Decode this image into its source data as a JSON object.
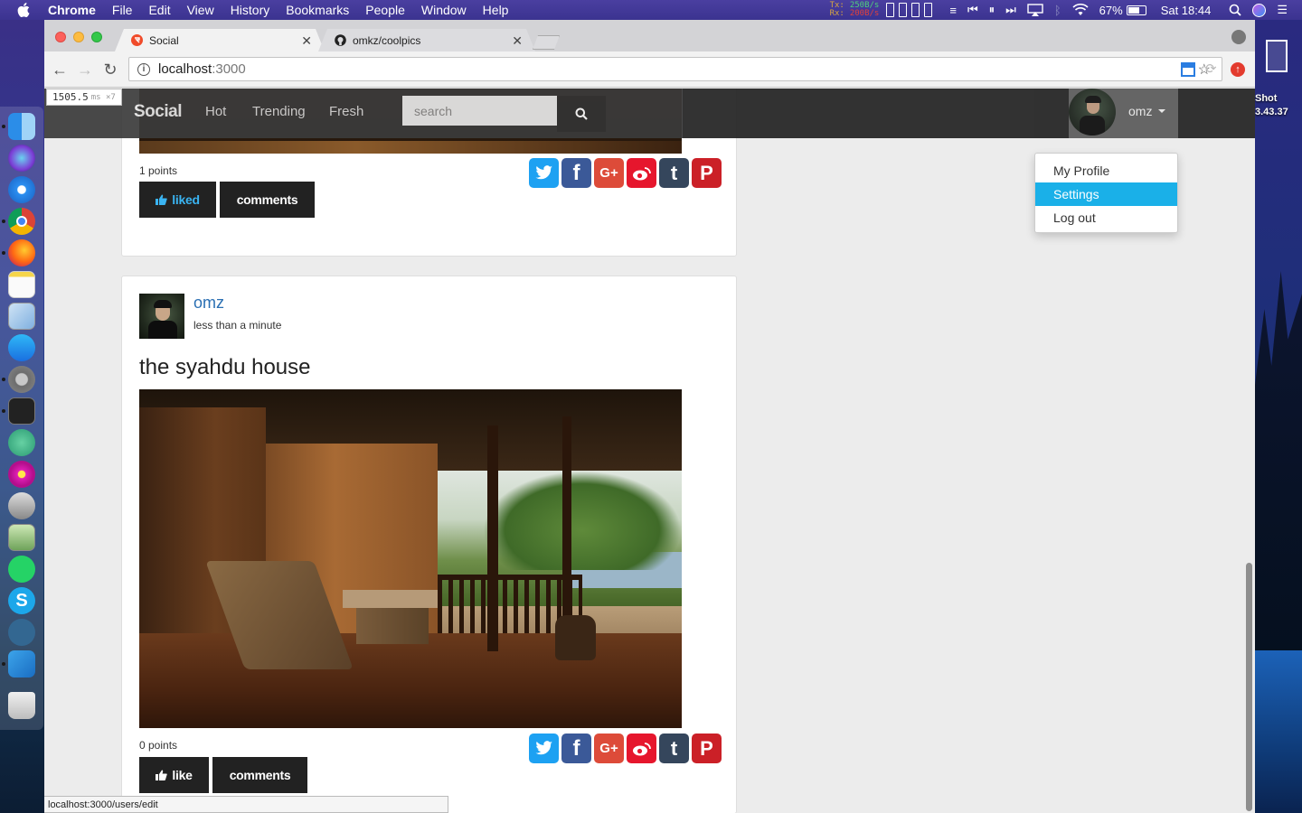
{
  "menubar": {
    "app_name": "Chrome",
    "items": [
      "File",
      "Edit",
      "View",
      "History",
      "Bookmarks",
      "People",
      "Window",
      "Help"
    ],
    "netstat": {
      "tx_label": "Tx:",
      "rx_label": "Rx:",
      "tx": "250B/s",
      "rx": "200B/s"
    },
    "battery": "67%",
    "clock": "Sat 18:44"
  },
  "desktop": {
    "icon_label_line1": "Shot",
    "icon_label_line2": "3.43.37"
  },
  "browser": {
    "tabs": [
      {
        "title": "Social",
        "active": true
      },
      {
        "title": "omkz/coolpics",
        "active": false
      }
    ],
    "url_host": "localhost",
    "url_port": ":3000",
    "status_url": "localhost:3000/users/edit"
  },
  "perf_overlay": {
    "value": "1505.5",
    "unit": "ms ×7"
  },
  "site": {
    "brand": "Social",
    "nav": [
      "Hot",
      "Trending",
      "Fresh"
    ],
    "search_placeholder": "search",
    "username": "omz",
    "dropdown": [
      {
        "label": "My Profile",
        "active": false
      },
      {
        "label": "Settings",
        "active": true
      },
      {
        "label": "Log out",
        "active": false
      }
    ]
  },
  "posts": [
    {
      "points": "1 points",
      "like_label": "liked",
      "comments_label": "comments"
    },
    {
      "author": "omz",
      "time": "less than a minute",
      "title": "the syahdu house",
      "points": "0 points",
      "like_label": "like",
      "comments_label": "comments"
    }
  ],
  "share_icons": [
    "twitter-icon",
    "facebook-icon",
    "google-plus-icon",
    "weibo-icon",
    "tumblr-icon",
    "pinterest-icon"
  ],
  "colors": {
    "twitter": "#1da1f2",
    "facebook": "#3b5998",
    "google_plus": "#dd4b39",
    "weibo": "#e6162d",
    "tumblr": "#35465c",
    "pinterest": "#cb2027",
    "dropdown_active": "#1ab0e8",
    "author_link": "#2a6fb3"
  }
}
